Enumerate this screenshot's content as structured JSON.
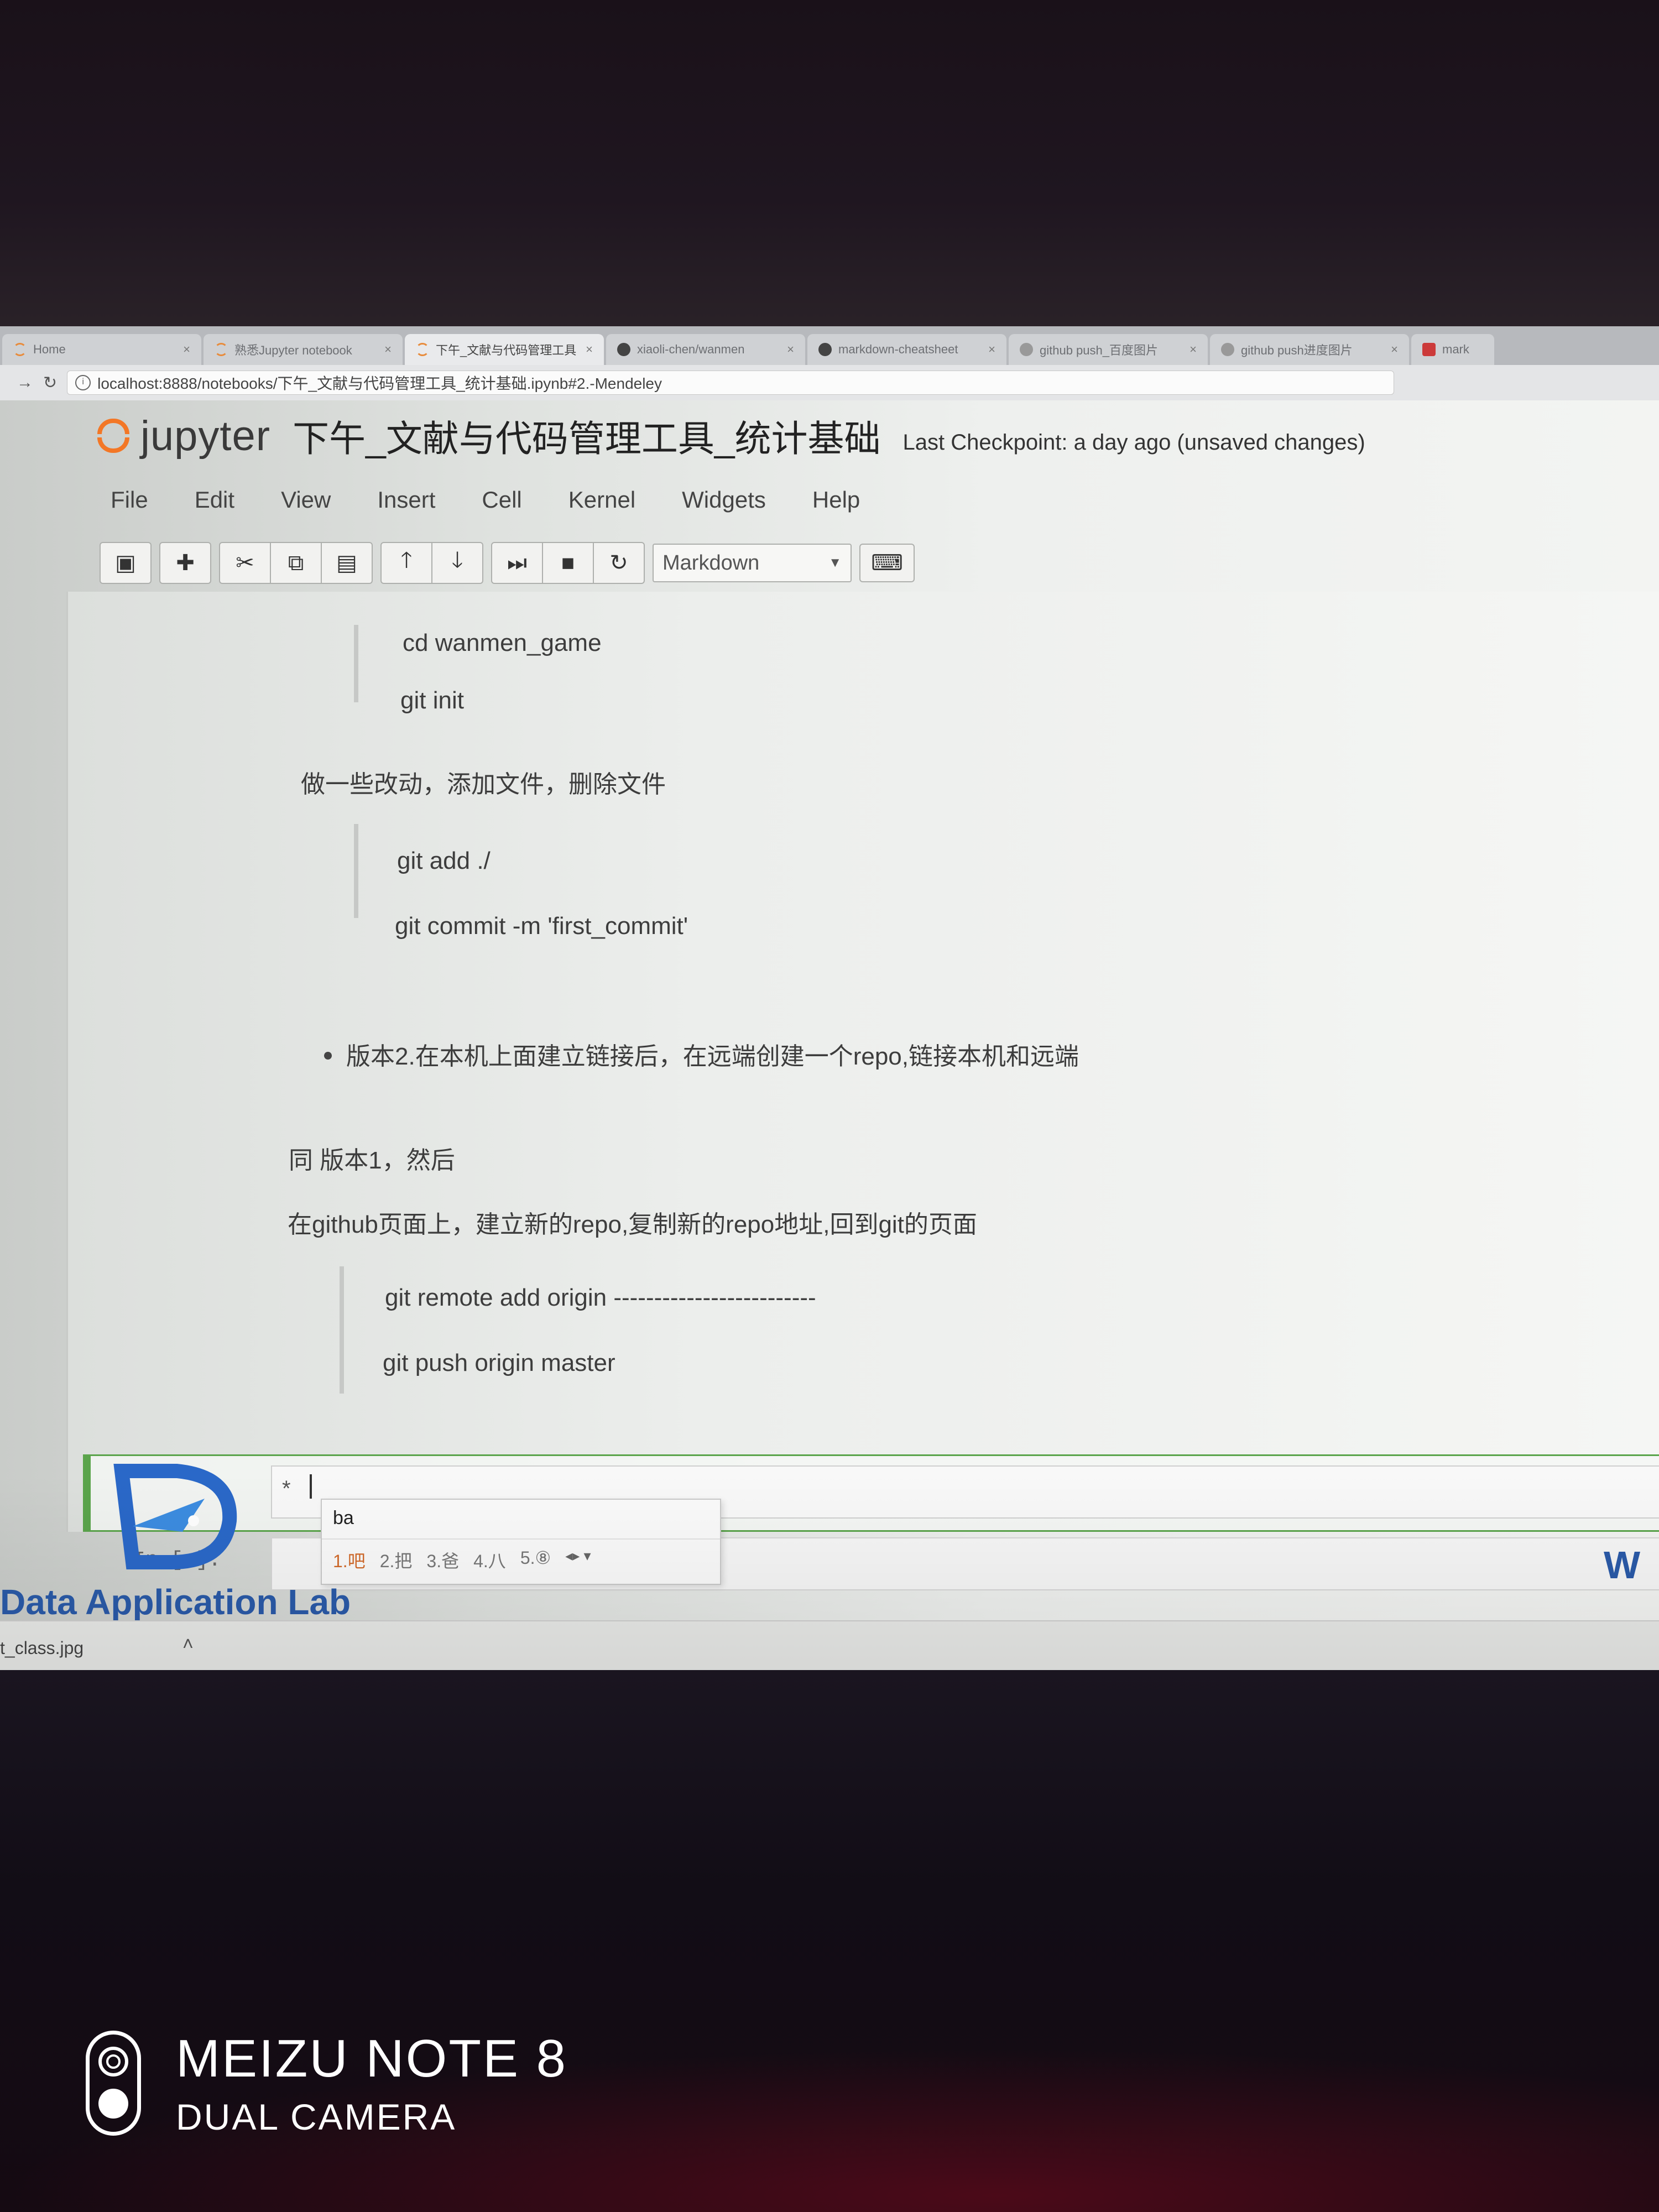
{
  "browser": {
    "tabs": [
      {
        "title": "Home",
        "icon": "jupyter-icon",
        "active": false
      },
      {
        "title": "熟悉Jupyter notebook",
        "icon": "jupyter-icon",
        "active": false
      },
      {
        "title": "下午_文献与代码管理工具",
        "icon": "jupyter-icon",
        "active": true
      },
      {
        "title": "xiaoli-chen/wanmen",
        "icon": "github-icon",
        "active": false
      },
      {
        "title": "markdown-cheatsheet",
        "icon": "github-icon",
        "active": false
      },
      {
        "title": "github push_百度图片",
        "icon": "baidu-icon",
        "active": false
      },
      {
        "title": "github push进度图片",
        "icon": "baidu-icon",
        "active": false
      },
      {
        "title": "mark",
        "icon": "red-icon",
        "active": false
      }
    ],
    "url": "localhost:8888/notebooks/下午_文献与代码管理工具_统计基础.ipynb#2.-Mendeley"
  },
  "jupyter": {
    "logo_text": "jupyter",
    "notebook_name": "下午_文献与代码管理工具_统计基础",
    "checkpoint": "Last Checkpoint: a day ago (unsaved changes)",
    "menu": [
      "File",
      "Edit",
      "View",
      "Insert",
      "Cell",
      "Kernel",
      "Widgets",
      "Help"
    ],
    "cell_type": "Markdown"
  },
  "content": {
    "q1_line1": "cd wanmen_game",
    "q1_line2": "git init",
    "para1": "做一些改动，添加文件，删除文件",
    "q2_line1": "git add ./",
    "q2_line2": "git commit -m 'first_commit'",
    "bullet": "版本2.在本机上面建立链接后，在远端创建一个repo,链接本机和远端",
    "para2": "同 版本1，然后",
    "para3": "在github页面上，建立新的repo,复制新的repo地址,回到git的页面",
    "q3_line1": "git remote add origin -------------------------",
    "q3_line2": "git push origin master"
  },
  "active_cell": {
    "marker": "*",
    "prompt": "In [ ]:"
  },
  "ime": {
    "input": "ba",
    "candidates": [
      "1.吧",
      "2.把",
      "3.爸",
      "4.八",
      "5.⑧"
    ]
  },
  "watermark": {
    "lab_name": "Data Application Lab",
    "right_text": "W"
  },
  "downloads": {
    "file": "t_class.jpg"
  },
  "camera": {
    "model": "MEIZU NOTE 8",
    "sub": "DUAL CAMERA"
  }
}
